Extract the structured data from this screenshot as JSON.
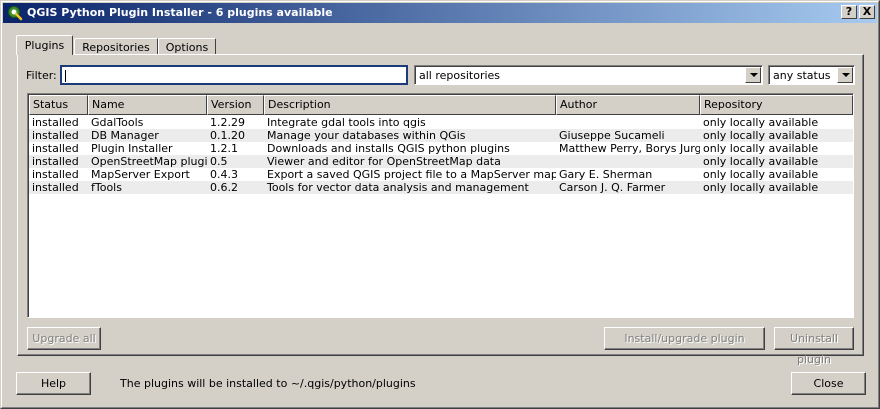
{
  "window": {
    "title": "QGIS Python Plugin Installer - 6 plugins available",
    "help_glyph": "?",
    "close_glyph": "X"
  },
  "tabs": [
    {
      "label": "Plugins",
      "active": true
    },
    {
      "label": "Repositories",
      "active": false
    },
    {
      "label": "Options",
      "active": false
    }
  ],
  "filter": {
    "label": "Filter:",
    "value": "",
    "repository_select": "all repositories",
    "status_select": "any status"
  },
  "table": {
    "columns": [
      "Status",
      "Name",
      "Version",
      "Description",
      "Author",
      "Repository"
    ],
    "rows": [
      {
        "status": "installed",
        "name": "GdalTools",
        "version": "1.2.29",
        "description": "Integrate gdal tools into qgis",
        "author": "",
        "repository": "only locally available"
      },
      {
        "status": "installed",
        "name": "DB Manager",
        "version": "0.1.20",
        "description": "Manage your databases within QGis",
        "author": "Giuseppe Sucameli",
        "repository": "only locally available"
      },
      {
        "status": "installed",
        "name": "Plugin Installer",
        "version": "1.2.1",
        "description": "Downloads and installs QGIS python plugins",
        "author": "Matthew Perry, Borys Jurgiel",
        "repository": "only locally available"
      },
      {
        "status": "installed",
        "name": "OpenStreetMap plugin",
        "version": "0.5",
        "description": "Viewer and editor for OpenStreetMap data",
        "author": "",
        "repository": "only locally available"
      },
      {
        "status": "installed",
        "name": "MapServer Export",
        "version": "0.4.3",
        "description": "Export a saved QGIS project file to a MapServer map file",
        "author": "Gary E. Sherman",
        "repository": "only locally available"
      },
      {
        "status": "installed",
        "name": "fTools",
        "version": "0.6.2",
        "description": "Tools for vector data analysis and management",
        "author": "Carson J. Q. Farmer",
        "repository": "only locally available"
      }
    ]
  },
  "buttons": {
    "upgrade_all": "Upgrade all",
    "install_upgrade": "Install/upgrade plugin",
    "uninstall": "Uninstall plugin",
    "help": "Help",
    "close": "Close"
  },
  "status_text": "The plugins will be installed to ~/.qgis/python/plugins",
  "colors": {
    "titlebar_start": "#0a246a",
    "titlebar_end": "#a6caf0",
    "window_bg": "#d4d0c8",
    "alt_row": "#ececec",
    "qgis_icon": "#3e8e2e"
  }
}
